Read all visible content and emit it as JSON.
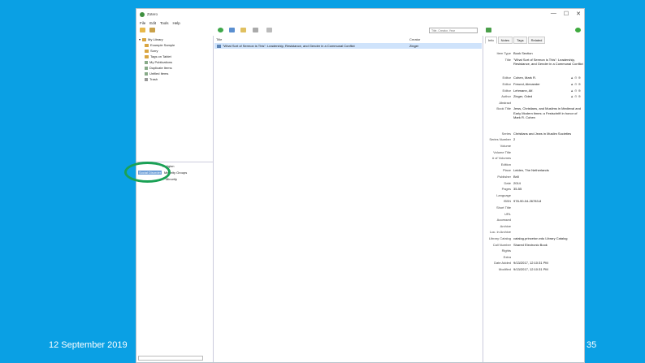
{
  "window": {
    "title": "Zotero",
    "minimize": "—",
    "maximize": "☐",
    "close": "✕"
  },
  "menu": [
    "File",
    "Edit",
    "Tools",
    "Help"
  ],
  "search": {
    "placeholder": "Title, Creator, Year"
  },
  "library": {
    "root": "My Library",
    "items": [
      "Example Sample",
      "Sorry",
      "Tags on Tablet",
      "My Publications",
      "Duplicate Items",
      "Unfiled Items",
      "Trash"
    ]
  },
  "tags": {
    "row1_suffix": "Religion",
    "selected": "Social Disorder",
    "row2_suffix": "Minority Groups",
    "row3_suffix": "Minority"
  },
  "columns": {
    "title": "Title",
    "creator": "Creator"
  },
  "item": {
    "title": "\"What Sort of Sermon is This\": Leadership, Resistance, and Gender in a Communal Conflict",
    "creator": "Zinger"
  },
  "tabs": [
    "Info",
    "Notes",
    "Tags",
    "Related"
  ],
  "fields": [
    {
      "label": "Item Type",
      "value": "Book Section"
    },
    {
      "label": "Title",
      "value": "\"What Sort of Sermon is This\": Leadership, Resistance, and Gender in a Communal Conflict"
    },
    {
      "label": "Editor",
      "value": "Cohen, Mark R."
    },
    {
      "label": "Editor",
      "value": "Freund, Alexander"
    },
    {
      "label": "Editor",
      "value": "Lehmann, Alf."
    },
    {
      "label": "Author",
      "value": "Zinger, Oded"
    },
    {
      "label": "Abstract",
      "value": ""
    },
    {
      "label": "Book Title",
      "value": "Jews, Christians, and Muslims in Medieval and Early Modern times: a Festschrift in honor of Mark R. Cohen"
    },
    {
      "label": "Series",
      "value": "Christians and Jews in Muslim Societies"
    },
    {
      "label": "Series Number",
      "value": "2"
    },
    {
      "label": "Volume",
      "value": ""
    },
    {
      "label": "Volume Title",
      "value": ""
    },
    {
      "label": "# of Volumes",
      "value": ""
    },
    {
      "label": "Edition",
      "value": ""
    },
    {
      "label": "Place",
      "value": "Leiden, The Netherlands"
    },
    {
      "label": "Publisher",
      "value": "Brill"
    },
    {
      "label": "Date",
      "value": "2014"
    },
    {
      "label": "Pages",
      "value": "35-55"
    },
    {
      "label": "Language",
      "value": ""
    },
    {
      "label": "ISBN",
      "value": "978-90-04-26783-8"
    },
    {
      "label": "Short Title",
      "value": ""
    },
    {
      "label": "URL",
      "value": ""
    },
    {
      "label": "Accessed",
      "value": ""
    },
    {
      "label": "Archive",
      "value": ""
    },
    {
      "label": "Loc. in Archive",
      "value": ""
    },
    {
      "label": "Library Catalog",
      "value": "catalog.princeton.edu Library Catalog"
    },
    {
      "label": "Call Number",
      "value": "Shared Electronic Book"
    },
    {
      "label": "Rights",
      "value": ""
    },
    {
      "label": "Extra",
      "value": ""
    },
    {
      "label": "Date Added",
      "value": "9/13/2017, 12:10:31 PM"
    },
    {
      "label": "Modified",
      "value": "9/13/2017, 12:10:31 PM"
    }
  ],
  "slide": {
    "date": "12 September 2019",
    "page": "35"
  },
  "colors": {
    "background": "#0aa0e4",
    "selection": "#cfe3fb",
    "highlight_ring": "#1aa155"
  }
}
